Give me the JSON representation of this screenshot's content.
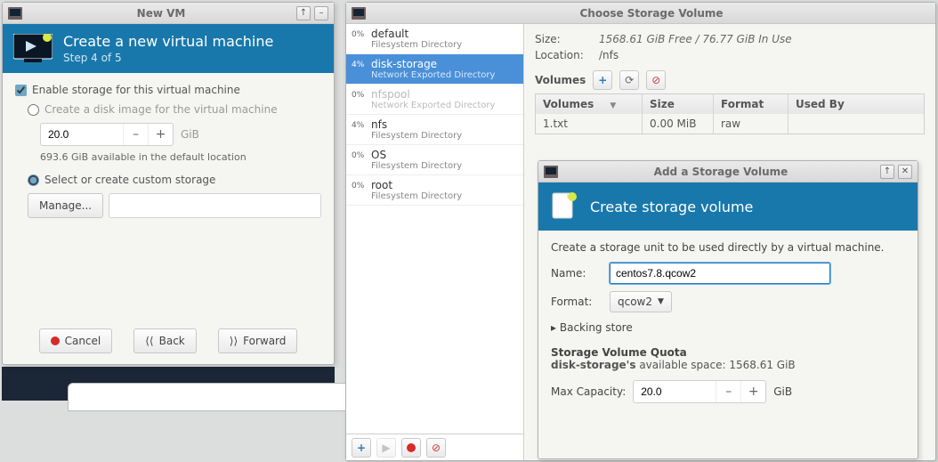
{
  "newvm": {
    "window_title": "New VM",
    "banner_title": "Create a new virtual machine",
    "banner_sub": "Step 4 of 5",
    "enable_storage": "Enable storage for this virtual machine",
    "create_disk_image": "Create a disk image for the virtual machine",
    "size_value": "20.0",
    "size_unit": "GiB",
    "available_hint": "693.6 GiB available in the default location",
    "select_custom": "Select or create custom storage",
    "manage": "Manage...",
    "cancel": "Cancel",
    "back": "Back",
    "forward": "Forward"
  },
  "storage": {
    "window_title": "Choose Storage Volume",
    "size_label": "Size:",
    "size_value": "1568.61 GiB Free / 76.77 GiB In Use",
    "location_label": "Location:",
    "location_value": "/nfs",
    "volumes_label": "Volumes",
    "table": {
      "h_volumes": "Volumes",
      "h_size": "Size",
      "h_format": "Format",
      "h_usedby": "Used By",
      "rows": [
        {
          "name": "1.txt",
          "size": "0.00 MiB",
          "format": "raw",
          "usedby": ""
        }
      ]
    },
    "pools": [
      {
        "pct": "0%",
        "name": "default",
        "sub": "Filesystem Directory",
        "dim": false,
        "sel": false
      },
      {
        "pct": "4%",
        "name": "disk-storage",
        "sub": "Network Exported Directory",
        "dim": false,
        "sel": true
      },
      {
        "pct": "0%",
        "name": "nfspool",
        "sub": "Network Exported Directory",
        "dim": true,
        "sel": false
      },
      {
        "pct": "4%",
        "name": "nfs",
        "sub": "Filesystem Directory",
        "dim": false,
        "sel": false
      },
      {
        "pct": "0%",
        "name": "OS",
        "sub": "Filesystem Directory",
        "dim": false,
        "sel": false
      },
      {
        "pct": "0%",
        "name": "root",
        "sub": "Filesystem Directory",
        "dim": false,
        "sel": false
      }
    ]
  },
  "addvol": {
    "window_title": "Add a Storage Volume",
    "banner_title": "Create storage volume",
    "intro": "Create a storage unit to be used directly by a virtual machine.",
    "name_label": "Name:",
    "name_value": "centos7.8.qcow2",
    "format_label": "Format:",
    "format_value": "qcow2",
    "backing": "Backing store",
    "quota_title": "Storage Volume Quota",
    "quota_pool": "disk-storage's",
    "quota_rest": " available space: 1568.61 GiB",
    "max_cap_label": "Max Capacity:",
    "max_cap_value": "20.0",
    "max_cap_unit": "GiB"
  },
  "icons": {
    "plus": "+",
    "refresh": "⟳",
    "delete": "⊘",
    "play": "▶",
    "up": "↑",
    "close": "✕",
    "chev": "▼",
    "tri": "▸",
    "back": "⟨⟨",
    "fwd": "⟩⟩"
  }
}
